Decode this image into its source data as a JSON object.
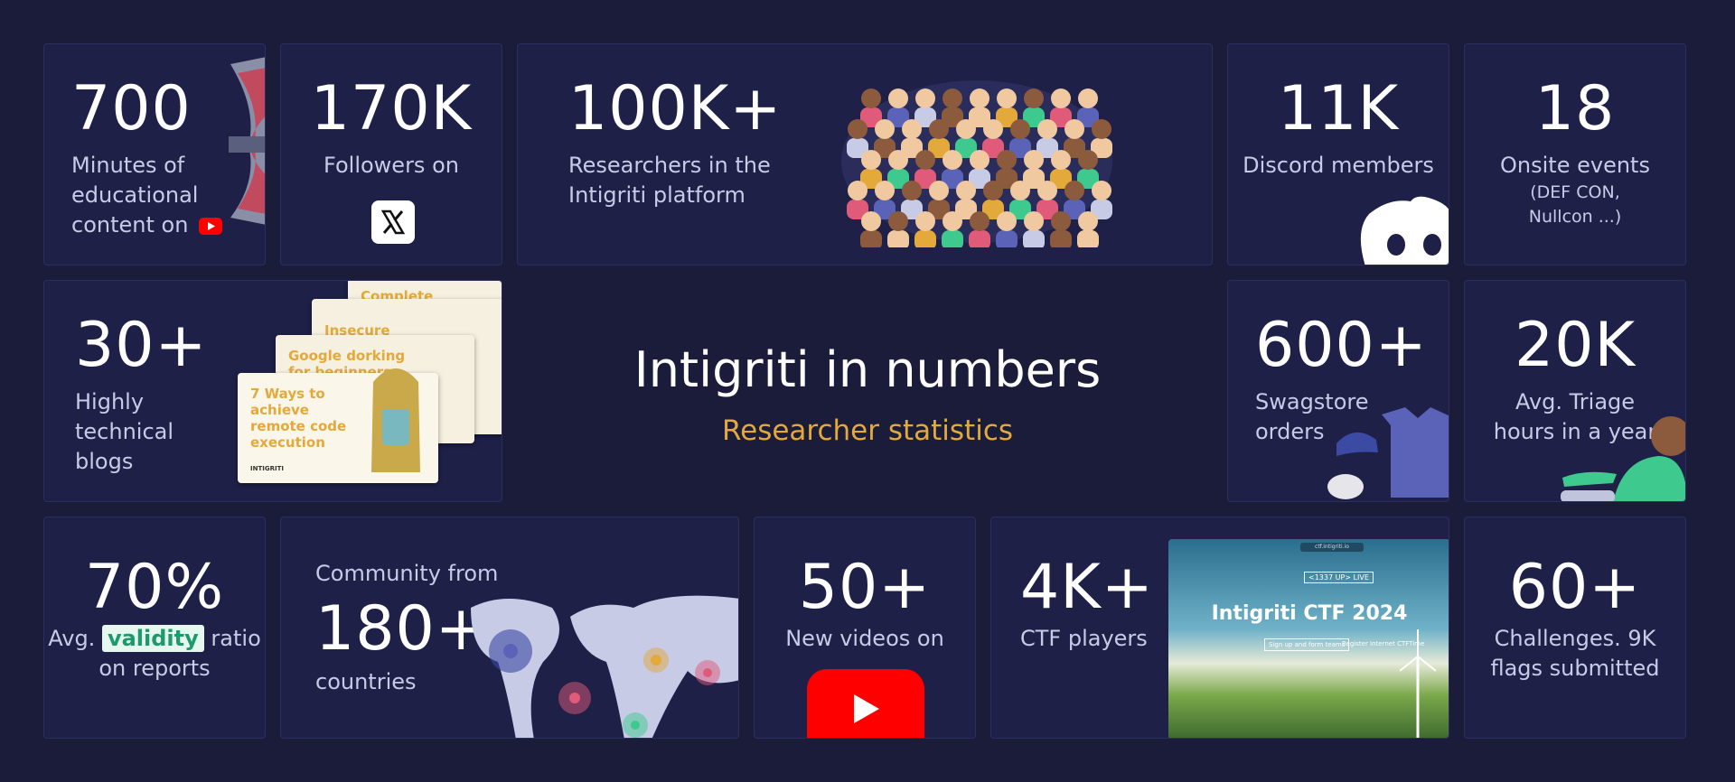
{
  "headline": {
    "title": "Intigriti in numbers",
    "subtitle": "Researcher statistics"
  },
  "stats": {
    "youtube_content": {
      "value": "700",
      "label_lines": [
        "Minutes of",
        "educational",
        "content on"
      ],
      "icon": "youtube-icon"
    },
    "followers": {
      "value": "170K",
      "label": "Followers on",
      "icon": "x-logo-icon"
    },
    "researchers": {
      "value": "100K+",
      "label_lines": [
        "Researchers in the",
        "Intigriti platform"
      ]
    },
    "discord": {
      "value": "11K",
      "label": "Discord members",
      "icon": "discord-icon"
    },
    "onsite": {
      "value": "18",
      "label": "Onsite events",
      "sub_lines": [
        "(DEF CON,",
        "Nullcon ...)"
      ]
    },
    "blogs": {
      "value": "30+",
      "label_lines": [
        "Highly",
        "technical",
        "blogs"
      ],
      "cards": [
        "Complete guide to finding more",
        "Insecure file uploads",
        "Google dorking for beginners",
        "7 Ways to achieve remote code execution"
      ],
      "card_brand": "INTIGRITI"
    },
    "swagstore": {
      "value": "600+",
      "label_lines": [
        "Swagstore",
        "orders"
      ]
    },
    "triage": {
      "value": "20K",
      "label_lines": [
        "Avg. Triage",
        "hours in a year"
      ]
    },
    "validity": {
      "value": "70%",
      "prefix": "Avg.",
      "highlight": "validity",
      "suffix": "ratio",
      "line2": "on reports"
    },
    "community": {
      "prefix": "Community from",
      "value": "180+",
      "label": "countries"
    },
    "videos": {
      "value": "50+",
      "label": "New videos on",
      "icon": "youtube-icon"
    },
    "ctf": {
      "value": "4K+",
      "label": "CTF players",
      "screenshot": {
        "url": "ctf.intigriti.io",
        "badge": "<1337 UP> LIVE",
        "title": "Intigriti CTF 2024",
        "btn1": "Sign up and form teams",
        "btn2": "Register Internet CTFTime"
      }
    },
    "challenges": {
      "value": "60+",
      "label_lines": [
        "Challenges. 9K",
        "flags submitted"
      ]
    }
  },
  "colors": {
    "background": "#1a1c3a",
    "tile": "#1e2048",
    "accent": "#e3a93b",
    "validity_text": "#1c9a6b",
    "youtube_red": "#ff0000"
  }
}
